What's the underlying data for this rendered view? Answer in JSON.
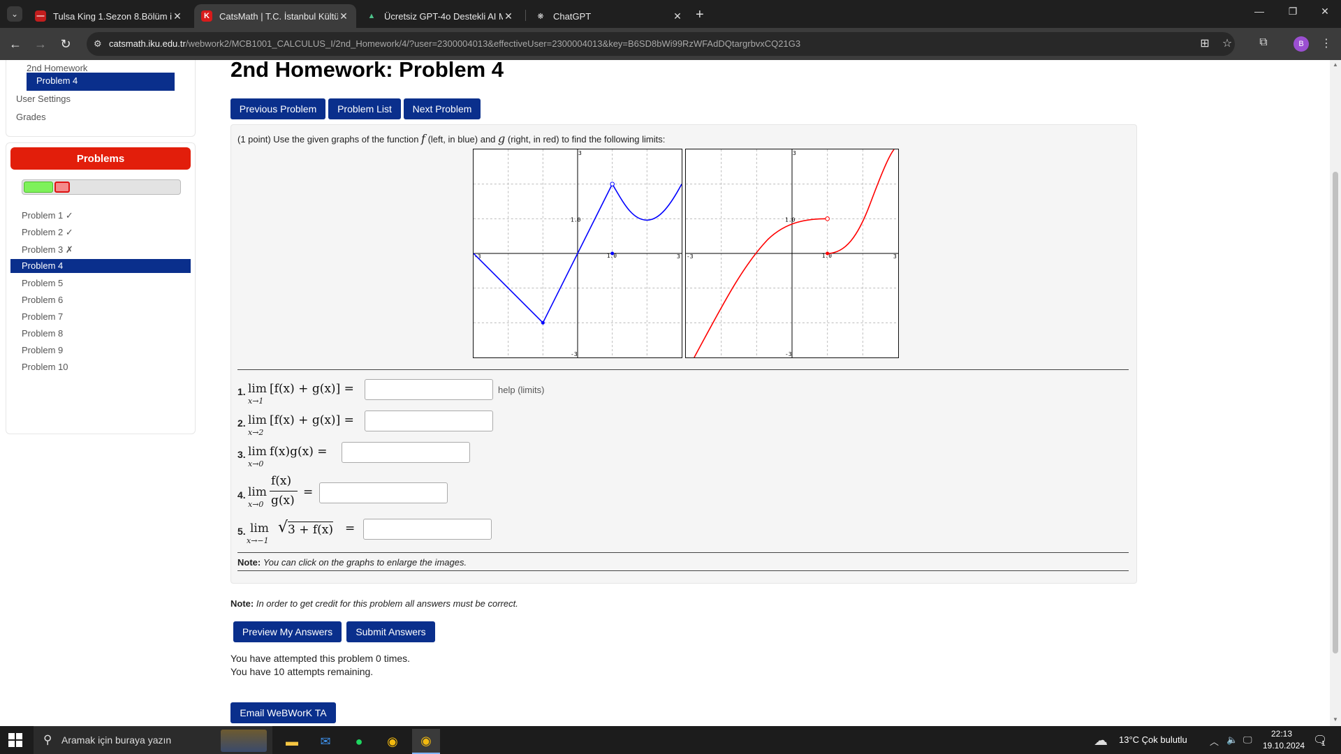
{
  "browser": {
    "tabs": [
      {
        "title": "Tulsa King 1.Sezon 8.Bölüm izle",
        "active": false
      },
      {
        "title": "CatsMath | T.C. İstanbul Kültür Ü",
        "active": true
      },
      {
        "title": "Ücretsiz GPT-4o Destekli AI Ma",
        "active": false
      },
      {
        "title": "ChatGPT",
        "active": false
      }
    ],
    "new_tab": "+",
    "url_host": "catsmath.iku.edu.tr",
    "url_path": "/webwork2/MCB1001_CALCULUS_I/2nd_Homework/4/?user=2300004013&effectiveUser=2300004013&key=B6SD8bWi99RzWFAdDQtargrbvxCQ21G3",
    "profile_initial": "B"
  },
  "sidebar": {
    "links": [
      "2nd Homework",
      "Problem 4",
      "User Settings",
      "Grades"
    ],
    "problems_title": "Problems",
    "progress": {
      "correct": 2,
      "incorrect": 1,
      "total": 10
    },
    "problems": [
      "Problem 1 ✓",
      "Problem 2 ✓",
      "Problem 3 ✗",
      "Problem 4",
      "Problem 5",
      "Problem 6",
      "Problem 7",
      "Problem 8",
      "Problem 9",
      "Problem 10"
    ]
  },
  "main": {
    "title": "2nd Homework: Problem 4",
    "nav_buttons": [
      "Previous Problem",
      "Problem List",
      "Next Problem"
    ],
    "intro_a": "(1 point) Use the given graphs of the function ",
    "intro_f": "f",
    "intro_b": " (left, in blue) and ",
    "intro_g": "g",
    "intro_c": " (right, in red) to find the following limits:",
    "graph_labels": {
      "top": "3",
      "bottom": "-3",
      "left": "-3",
      "right": "3",
      "one_y": "1.0",
      "one_x": "1.0"
    },
    "questions": [
      {
        "num": "1.",
        "sub": "x→1",
        "expr": "[f(x) + g(x)] ="
      },
      {
        "num": "2.",
        "sub": "x→2",
        "expr": "[f(x) + g(x)] ="
      },
      {
        "num": "3.",
        "sub": "x→0",
        "expr": "f(x)g(x) ="
      },
      {
        "num": "4.",
        "sub": "x→0",
        "numer": "f(x)",
        "denom": "g(x)",
        "eq": "="
      },
      {
        "num": "5.",
        "sub": "x→−1",
        "radicand": "3 + f(x)",
        "eq": "="
      }
    ],
    "lim_word": "lim",
    "help_text": "help (limits)",
    "note1_label": "Note:",
    "note1_text": "You can click on the graphs to enlarge the images.",
    "note2_label": "Note:",
    "note2_text": "In order to get credit for this problem all answers must be correct.",
    "action_buttons": [
      "Preview My Answers",
      "Submit Answers"
    ],
    "attempts": [
      "You have attempted this problem 0 times.",
      "You have 10 attempts remaining."
    ],
    "email_button": "Email WeBWorK TA"
  },
  "taskbar": {
    "search_placeholder": "Aramak için buraya yazın",
    "weather": "13°C  Çok bulutlu",
    "time": "22:13",
    "date": "19.10.2024",
    "notif_count": "1"
  },
  "colors": {
    "accent": "#0a2f8c",
    "problems_header": "#e21e0b",
    "f_curve": "#0000ff",
    "g_curve": "#ff0000"
  }
}
